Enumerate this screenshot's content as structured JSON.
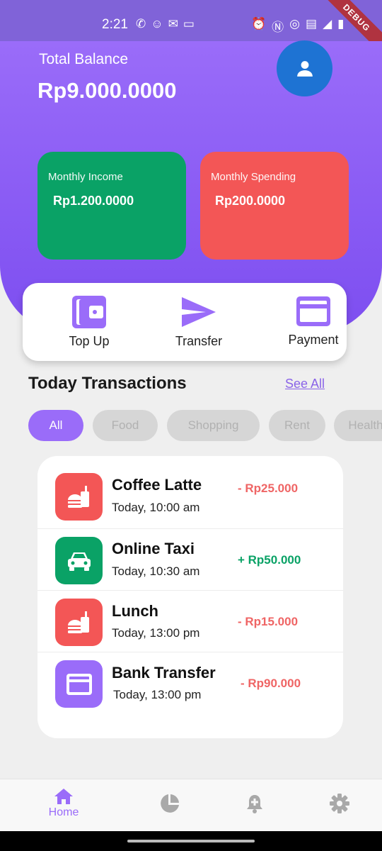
{
  "status_bar": {
    "time": "2:21",
    "debug_label": "DEBUG"
  },
  "header": {
    "balance_label": "Total Balance",
    "balance_value": "Rp9.000.0000",
    "income": {
      "label": "Monthly Income",
      "value": "Rp1.200.0000"
    },
    "spending": {
      "label": "Monthly Spending",
      "value": "Rp200.0000"
    }
  },
  "actions": [
    {
      "label": "Top Up",
      "icon": "wallet-icon"
    },
    {
      "label": "Transfer",
      "icon": "send-icon"
    },
    {
      "label": "Payment",
      "icon": "card-icon"
    }
  ],
  "transactions_section": {
    "title": "Today Transactions",
    "see_all": "See All",
    "filters": [
      "All",
      "Food",
      "Shopping",
      "Rent",
      "Health"
    ],
    "selected_filter": "All",
    "items": [
      {
        "title": "Coffee Latte",
        "time": "Today, 10:00 am",
        "amount": "- Rp25.000",
        "type": "expense",
        "icon": "fastfood-icon"
      },
      {
        "title": "Online Taxi",
        "time": "Today, 10:30 am",
        "amount": "+ Rp50.000",
        "type": "income",
        "icon": "car-icon"
      },
      {
        "title": "Lunch",
        "time": "Today, 13:00 pm",
        "amount": "- Rp15.000",
        "type": "expense",
        "icon": "fastfood-icon"
      },
      {
        "title": "Bank Transfer",
        "time": "Today, 13:00 pm",
        "amount": "- Rp90.000",
        "type": "expense",
        "icon": "card-icon"
      }
    ]
  },
  "bottom_nav": {
    "items": [
      {
        "label": "Home",
        "icon": "home-icon",
        "active": true
      },
      {
        "label": "",
        "icon": "pie-chart-icon",
        "active": false
      },
      {
        "label": "",
        "icon": "notification-add-icon",
        "active": false
      },
      {
        "label": "",
        "icon": "settings-icon",
        "active": false
      }
    ]
  },
  "colors": {
    "primary": "#9a6cf9",
    "income": "#0aa266",
    "expense": "#f35656",
    "avatar": "#1e73d3"
  }
}
